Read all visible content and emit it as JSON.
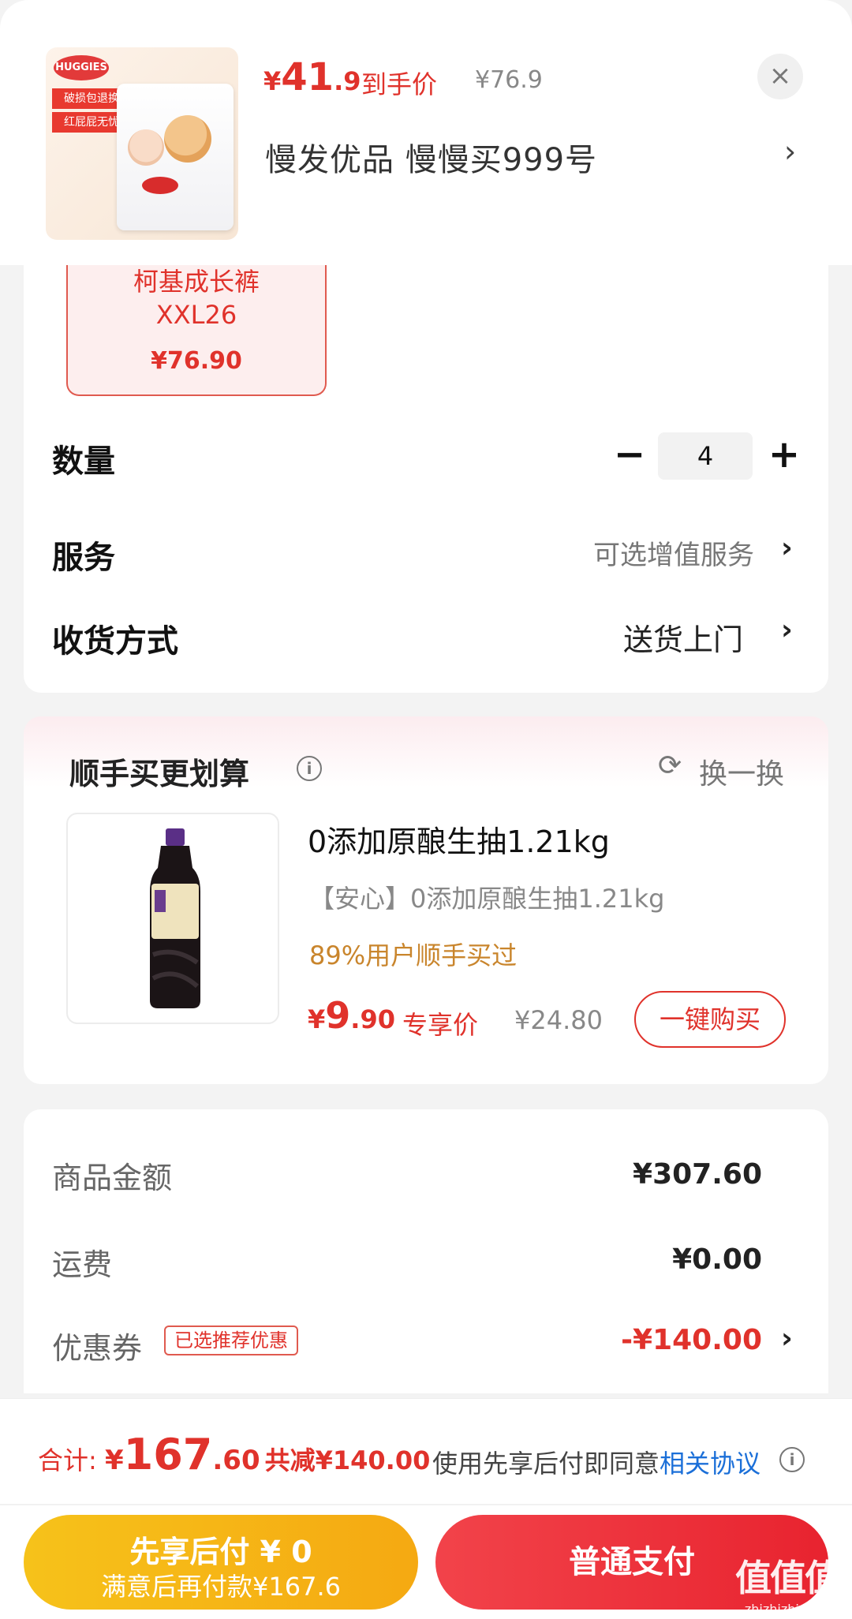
{
  "header": {
    "price_yen": "¥",
    "price_int": "41",
    "price_dec": ".9",
    "price_label": "到手价",
    "original_price": "¥76.9",
    "close_icon": "×",
    "shop_name": "慢发优品  慢慢买999号",
    "arrow": "›",
    "thumb_tags": [
      "破损包退换",
      "红屁屁无忧"
    ]
  },
  "sku": {
    "name_line1": "柯基成长裤",
    "name_line2": "XXL26",
    "price": "¥76.90"
  },
  "quantity": {
    "label": "数量",
    "minus": "−",
    "value": "4",
    "plus": "+"
  },
  "service": {
    "label": "服务",
    "value": "可选增值服务",
    "arrow": "›"
  },
  "delivery": {
    "label": "收货方式",
    "value": "送货上门",
    "arrow": "›"
  },
  "upsell": {
    "title": "顺手买更划算",
    "info_icon": "i",
    "refresh_icon": "⟳",
    "refresh_label": "换一换",
    "product_title": "0添加原酿生抽1.21kg",
    "product_sub": "【安心】0添加原酿生抽1.21kg",
    "stat": "89%用户顺手买过",
    "price_yen": "¥",
    "price_int": "9",
    "price_dec": ".90",
    "price_tag": "专享价",
    "original_price": "¥24.80",
    "buy_button": "一键购买"
  },
  "summary": {
    "goods_label": "商品金额",
    "goods_value": "¥307.60",
    "shipping_label": "运费",
    "shipping_value": "¥0.00",
    "coupon_label": "优惠券",
    "coupon_badge": "已选推荐优惠",
    "coupon_value": "-¥140.00",
    "arrow": "›"
  },
  "bottom": {
    "total_label": "合计: ",
    "total_yen": "¥",
    "total_int": "167",
    "total_dec": ".60",
    "total_saved": "共减¥140.00",
    "agree_text": "使用先享后付即同意",
    "agree_link": "相关协议",
    "info_icon": "i",
    "later_line1": "先享后付 ¥ 0",
    "later_line2": "满意后再付款¥167.6",
    "pay_button": "普通支付",
    "watermark_main": "值值值",
    "watermark_sub": "zhizhizhi.com"
  },
  "colors": {
    "accent_red": "#e0322b",
    "pay_button": "#e8232f",
    "later_button": "#f5b314",
    "link_blue": "#1b6fd8",
    "stat_gold": "#c9852c"
  }
}
